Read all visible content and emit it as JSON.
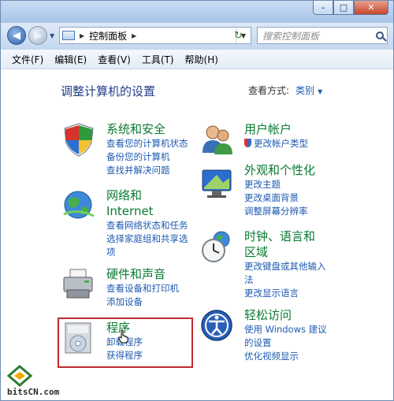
{
  "window": {
    "controls": [
      "–",
      "□",
      "✕"
    ]
  },
  "nav": {
    "breadcrumb": "控制面板",
    "search_placeholder": "搜索控制面板"
  },
  "menu": [
    "文件(F)",
    "编辑(E)",
    "查看(V)",
    "工具(T)",
    "帮助(H)"
  ],
  "page": {
    "title": "调整计算机的设置",
    "view_label": "查看方式:",
    "view_value": "类别"
  },
  "categories": [
    {
      "title": "系统和安全",
      "links": [
        "查看您的计算机状态",
        "备份您的计算机",
        "查找并解决问题"
      ]
    },
    {
      "title_line1": "网络和",
      "title_line2": "Internet",
      "links": [
        "查看网络状态和任务",
        "选择家庭组和共享选",
        "项"
      ]
    },
    {
      "title": "硬件和声音",
      "links": [
        "查看设备和打印机",
        "添加设备"
      ]
    },
    {
      "title": "程序",
      "links": [
        "卸载程序",
        "获得程序"
      ]
    },
    {
      "title": "用户帐户",
      "links": [
        "更改帐户类型"
      ]
    },
    {
      "title": "外观和个性化",
      "links": [
        "更改主题",
        "更改桌面背景",
        "调整屏幕分辨率"
      ]
    },
    {
      "title_line1": "时钟、语言和",
      "title_line2": "区域",
      "links": [
        "更改键盘或其他输入",
        "法",
        "更改显示语言"
      ]
    },
    {
      "title": "轻松访问",
      "links": [
        "使用 Windows 建议",
        "的设置",
        "优化视频显示"
      ]
    }
  ],
  "watermark": {
    "text": "bitsCN.com"
  },
  "colors": {
    "title_green": "#0a7a32",
    "link_blue": "#1f5ab0",
    "highlight_red": "#c32a31"
  }
}
